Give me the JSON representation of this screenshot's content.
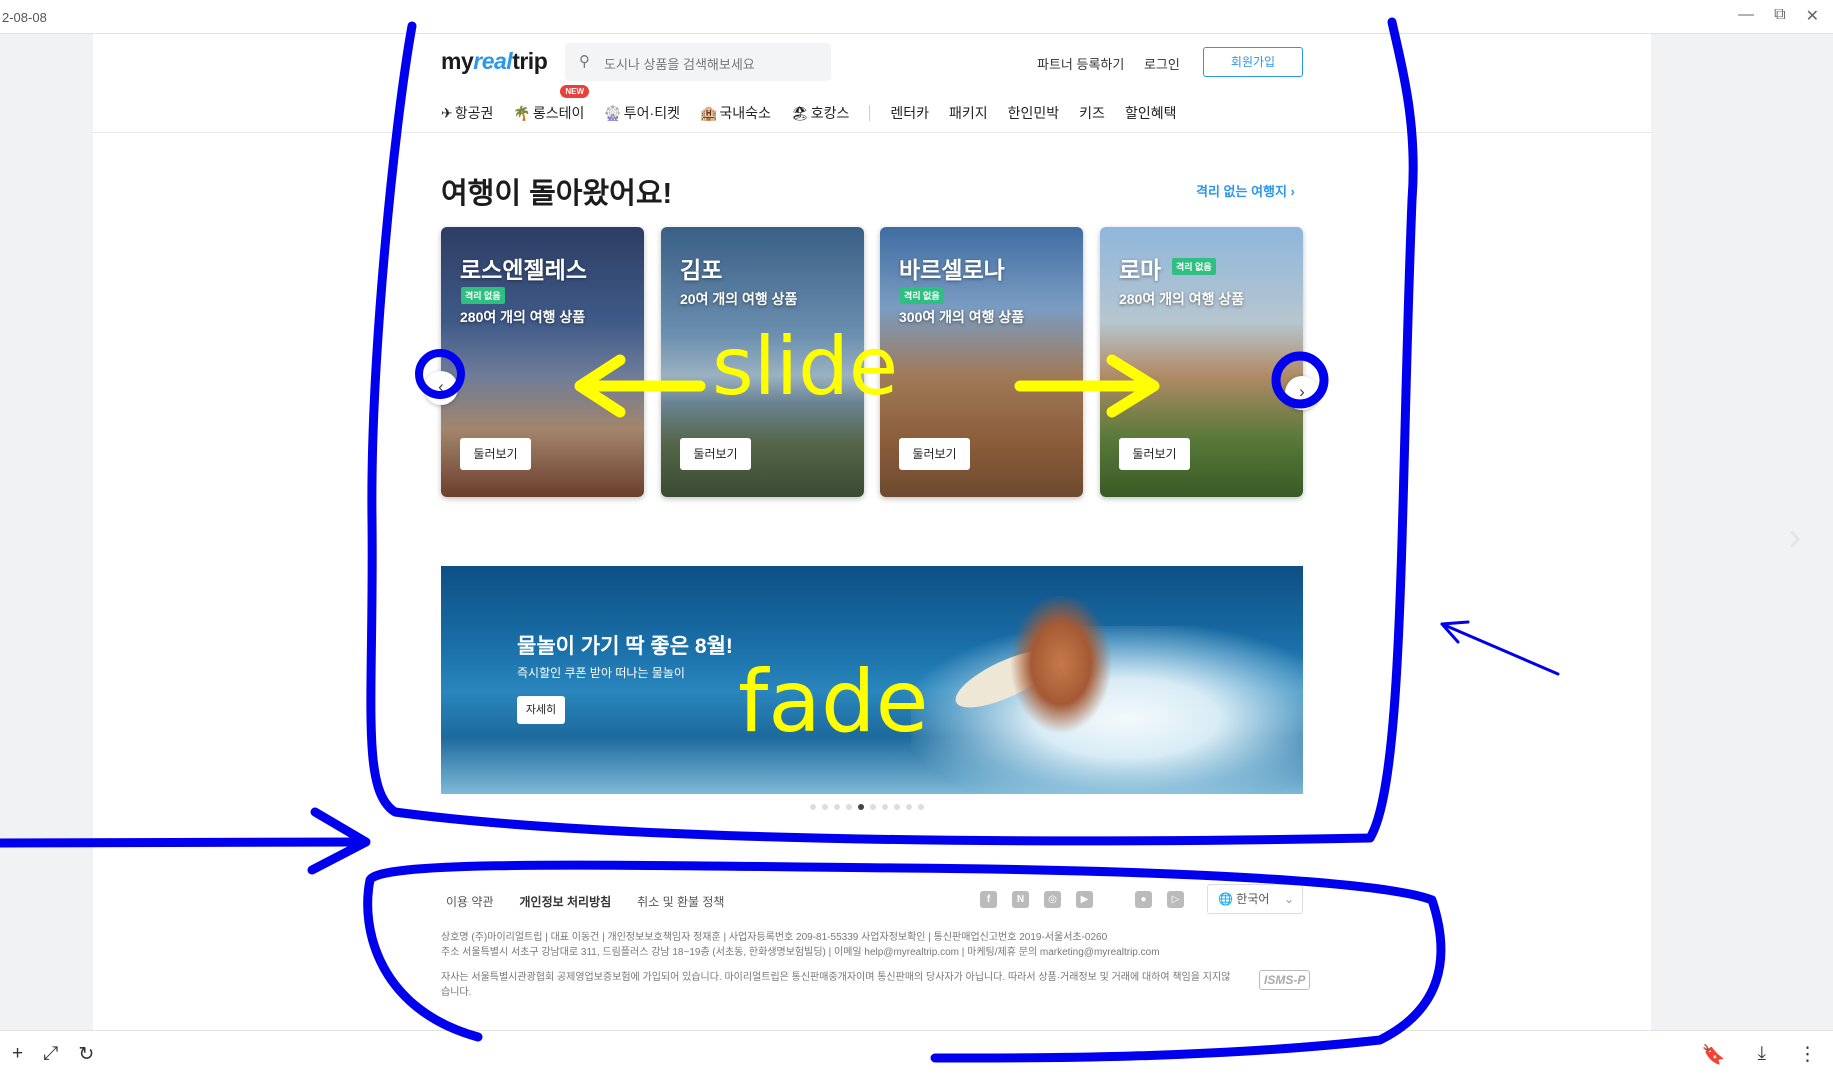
{
  "viewer": {
    "date": "2-08-08",
    "win_min": "—",
    "win_max": "⧉",
    "win_close": "✕",
    "btn_add": "+",
    "btn_expand": "⤢",
    "btn_rotate": "↻",
    "btn_bookmark": "🔖",
    "btn_download": "⤓",
    "btn_more": "⋮",
    "side_next": "›"
  },
  "header": {
    "logo_my": "my",
    "logo_real": "real",
    "logo_trip": "trip",
    "search_placeholder": "도시나 상품을 검색해보세요",
    "partner": "파트너 등록하기",
    "login": "로그인",
    "join": "회원가입"
  },
  "nav": {
    "items": [
      {
        "icon": "✈",
        "label": "항공권"
      },
      {
        "icon": "🌴",
        "label": "롱스테이",
        "badge": "NEW"
      },
      {
        "icon": "🎡",
        "label": "투어·티켓"
      },
      {
        "icon": "🏨",
        "label": "국내숙소"
      },
      {
        "icon": "🏖",
        "label": "호캉스"
      }
    ],
    "text_items": [
      "렌터카",
      "패키지",
      "한인민박",
      "키즈",
      "할인혜택"
    ]
  },
  "section": {
    "title": "여행이 돌아왔어요!",
    "link": "격리 없는 여행지 ›"
  },
  "cards": [
    {
      "name": "로스엔젤레스",
      "badge": "격리 없음",
      "count": "280여 개의 여행 상품",
      "button": "둘러보기"
    },
    {
      "name": "김포",
      "badge": "",
      "count": "20여 개의 여행 상품",
      "button": "둘러보기"
    },
    {
      "name": "바르셀로나",
      "badge": "격리 없음",
      "count": "300여 개의 여행 상품",
      "button": "둘러보기"
    },
    {
      "name": "로마",
      "badge": "격리 없음",
      "count": "280여 개의 여행 상품",
      "button": "둘러보기"
    }
  ],
  "carousel": {
    "prev": "‹",
    "next": "›"
  },
  "banner": {
    "title": "물놀이 가기 딱 좋은 8월!",
    "subtitle": "즉시할인 쿠폰 받아 떠나는 물놀이",
    "button": "자세히",
    "dots_total": 10,
    "dots_active_index": 4
  },
  "footer": {
    "links": [
      "이용 약관",
      "개인정보 처리방침",
      "취소 및 환불 정책"
    ],
    "social": [
      "facebook-icon",
      "naver-blog-icon",
      "instagram-icon",
      "youtube-icon",
      "apple-icon",
      "google-play-icon"
    ],
    "language": "한국어",
    "info_line1": "상호명 (주)마이리얼트립 | 대표 이동건 | 개인정보보호책임자 정재훈 | 사업자등록번호 209-81-55339 사업자정보확인 | 통신판매업신고번호 2019-서울서초-0260",
    "info_line2": "주소 서울특별시 서초구 강남대로 311, 드림플러스 강남 18~19층 (서초동, 한화생명보험빌딩) | 이메일 help@myrealtrip.com | 마케팅/제휴 문의 marketing@myrealtrip.com",
    "info_line3": "자사는 서울특별시관광협회 공제영업보증보험에 가입되어 있습니다. 마이리얼트립은 통신판매중개자이며 통신판매의 당사자가 아닙니다. 따라서 상품·거래정보 및 거래에 대하여 책임을 지지않",
    "info_line4": "습니다.",
    "isms": "ISMS-P"
  },
  "annotations": {
    "slide": "slide",
    "fade": "fade",
    "ink_color": "#0000ee",
    "text_color": "#ffff00"
  }
}
